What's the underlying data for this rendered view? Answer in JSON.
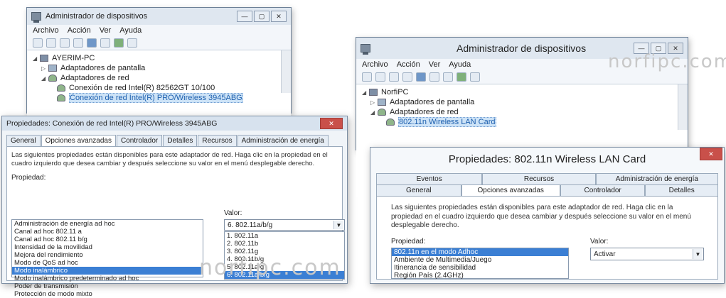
{
  "left_window": {
    "title": "Administrador de dispositivos",
    "menu": [
      "Archivo",
      "Acción",
      "Ver",
      "Ayuda"
    ],
    "tree": [
      {
        "label": "AYERIM-PC",
        "indent": 0,
        "icon": "computer-icon"
      },
      {
        "label": "Adaptadores de pantalla",
        "indent": 1,
        "icon": "display-adapter-icon"
      },
      {
        "label": "Adaptadores de red",
        "indent": 1,
        "icon": "network-adapter-icon"
      },
      {
        "label": "Conexión de red Intel(R) 82562GT 10/100",
        "indent": 2,
        "icon": "network-card-icon"
      },
      {
        "label": "Conexión de red Intel(R) PRO/Wireless 3945ABG",
        "indent": 2,
        "icon": "network-card-icon"
      }
    ]
  },
  "left_dialog": {
    "title": "Propiedades: Conexión de red Intel(R) PRO/Wireless 3945ABG",
    "tabs": [
      "General",
      "Opciones avanzadas",
      "Controlador",
      "Detalles",
      "Recursos",
      "Administración de energía"
    ],
    "active_tab": "Opciones avanzadas",
    "description": "Las siguientes propiedades están disponibles para este adaptador de red. Haga clic en la propiedad en el cuadro izquierdo que desea cambiar y después seleccione su valor en el menú desplegable derecho.",
    "property_label": "Propiedad:",
    "value_label": "Valor:",
    "properties": [
      "Administración de energía ad hoc",
      "Canal ad hoc 802.11 a",
      "Canal ad hoc 802.11 b/g",
      "Intensidad de la movilidad",
      "Mejora del rendimiento",
      "Modo de QoS ad hoc",
      "Modo inalámbrico",
      "Modo inalámbrico predeterminado ad hoc",
      "Poder de transmisión",
      "Protección de modo mixto"
    ],
    "selected_property_index": 6,
    "value_selected": "6. 802.11a/b/g",
    "value_options": [
      "1. 802.11a",
      "2. 802.11b",
      "3. 802.11g",
      "4. 802.11b/g",
      "5. 802.11a/g",
      "6. 802.11a/b/g"
    ],
    "selected_value_index": 5
  },
  "right_window": {
    "title": "Administrador de dispositivos",
    "menu": [
      "Archivo",
      "Acción",
      "Ver",
      "Ayuda"
    ],
    "tree": [
      {
        "label": "NorfiPC",
        "indent": 0,
        "icon": "computer-icon"
      },
      {
        "label": "Adaptadores de pantalla",
        "indent": 1,
        "icon": "display-adapter-icon"
      },
      {
        "label": "Adaptadores de red",
        "indent": 1,
        "icon": "network-adapter-icon"
      },
      {
        "label": "802.11n Wireless LAN Card",
        "indent": 2,
        "icon": "network-card-icon"
      }
    ]
  },
  "right_dialog": {
    "title": "Propiedades: 802.11n Wireless LAN Card",
    "tabs_row1": [
      "Eventos",
      "Recursos",
      "Administración de energía"
    ],
    "tabs_row2": [
      "General",
      "Opciones avanzadas",
      "Controlador",
      "Detalles"
    ],
    "active_tab": "Opciones avanzadas",
    "description": "Las siguientes propiedades están disponibles para este adaptador de red. Haga clic en la propiedad en el cuadro izquierdo que desea cambiar y después seleccione su valor en el menú desplegable derecho.",
    "property_label": "Propiedad:",
    "value_label": "Valor:",
    "properties": [
      "802.11n en el modo Adhoc",
      "Ambiente de Multimedia/Juego",
      "Itinerancia de sensibilidad",
      "Región País (2.4GHz)"
    ],
    "selected_property_index": 0,
    "value": "Activar"
  },
  "watermarks": [
    "norfipc.com",
    "norfipc.com"
  ],
  "colors": {
    "selection": "#3b7fd4",
    "close": "#c9504a",
    "window_frame": "#dfe7f0"
  }
}
